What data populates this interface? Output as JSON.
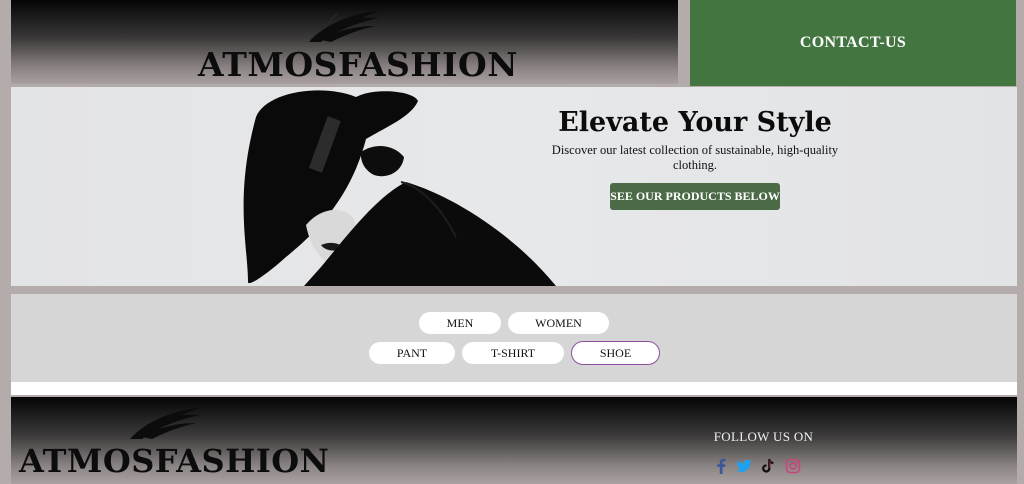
{
  "header": {
    "brand": "ATMOSFASHION",
    "contact_label": "CONTACT-US"
  },
  "hero": {
    "title": "Elevate Your Style",
    "subtitle": "Discover our latest collection of sustainable, high-quality clothing.",
    "cta_label": "SEE OUR PRODUCTS BELOW"
  },
  "filters": {
    "row1": [
      "MEN",
      "WOMEN"
    ],
    "row2": [
      "PANT",
      "T-SHIRT",
      "SHOE"
    ],
    "active": "SHOE"
  },
  "footer": {
    "brand": "ATMOSFASHION",
    "follow_label": "FOLLOW US ON",
    "social": [
      "facebook-icon",
      "twitter-icon",
      "tiktok-icon",
      "instagram-icon"
    ]
  },
  "colors": {
    "brand_green": "#437540",
    "button_green": "#4a6b46",
    "active_outline": "#8f4f9e",
    "facebook": "#3b5998",
    "twitter": "#1da1f2",
    "instagram": "#c8467a"
  }
}
